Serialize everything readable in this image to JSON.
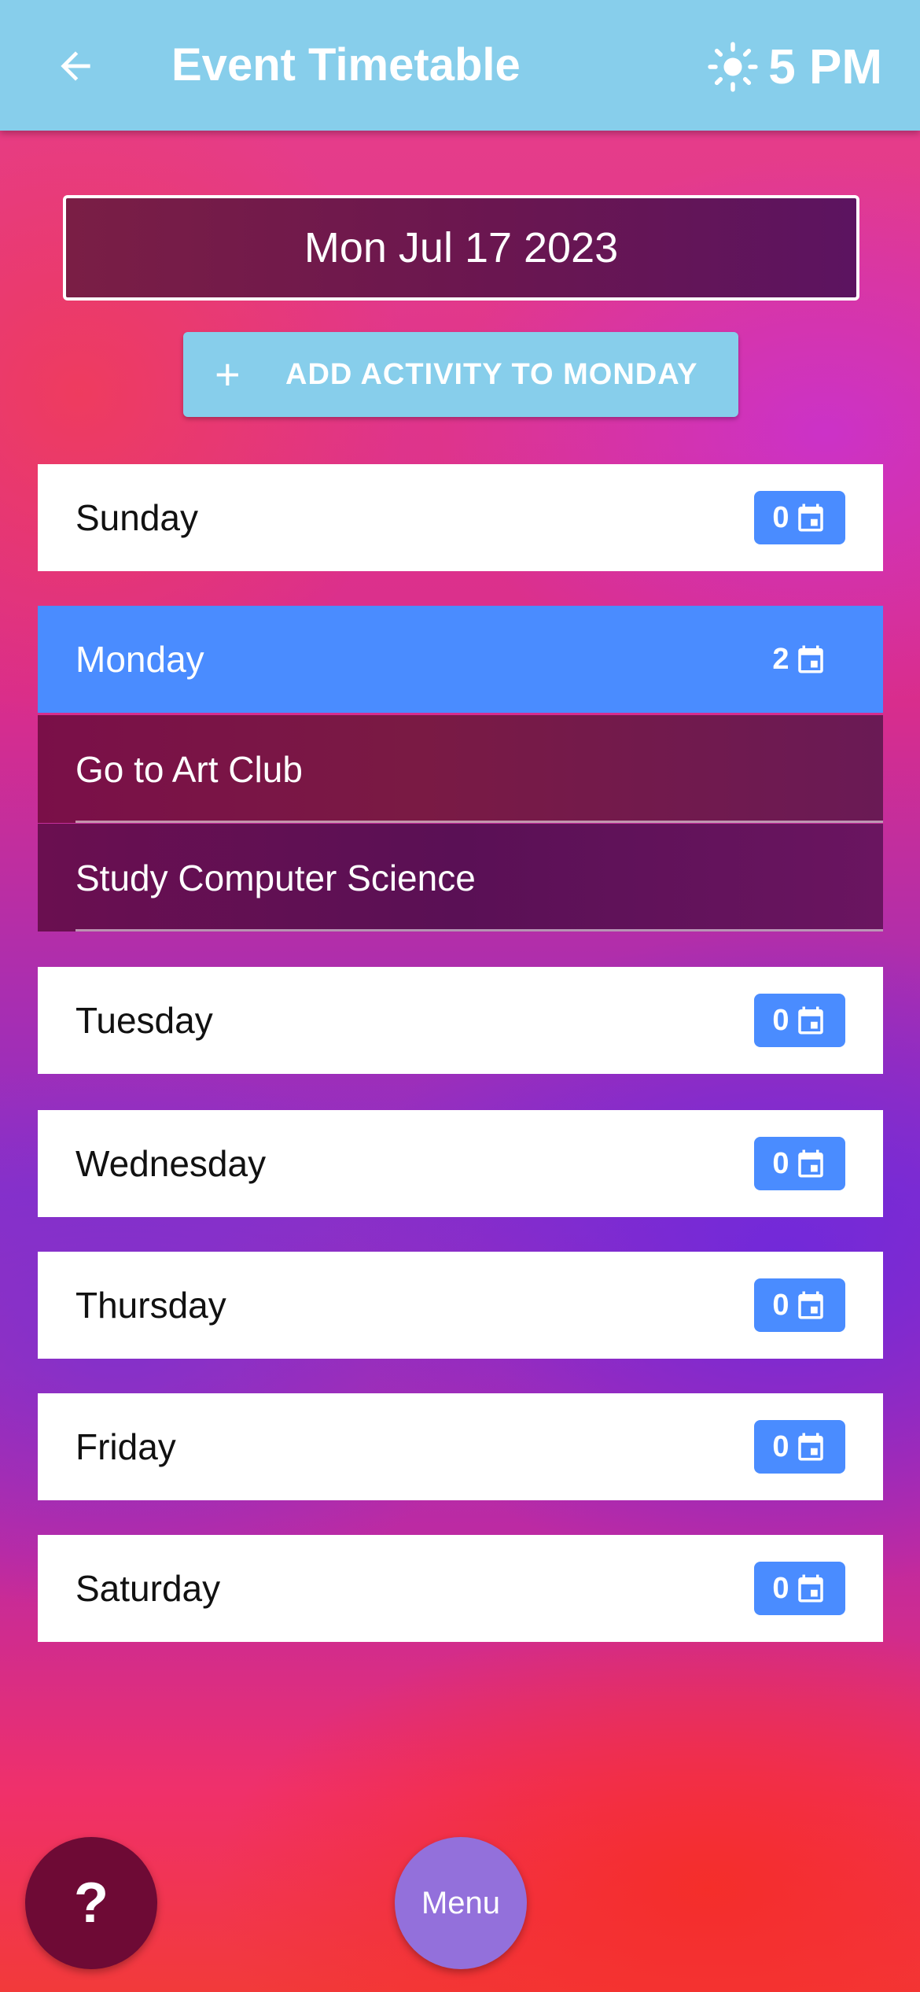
{
  "header": {
    "title": "Event Timetable",
    "weather_text": "5 PM",
    "back_icon": "arrow-left-icon",
    "weather_icon": "sun-icon"
  },
  "date": {
    "label": "Mon Jul 17 2023"
  },
  "add_button": {
    "icon": "+",
    "label": "ADD ACTIVITY TO MONDAY"
  },
  "days": [
    {
      "name": "Sunday",
      "count": "0"
    },
    {
      "name": "Monday",
      "count": "2"
    },
    {
      "name": "Tuesday",
      "count": "0"
    },
    {
      "name": "Wednesday",
      "count": "0"
    },
    {
      "name": "Thursday",
      "count": "0"
    },
    {
      "name": "Friday",
      "count": "0"
    },
    {
      "name": "Saturday",
      "count": "0"
    }
  ],
  "monday_activities": [
    "Go to Art Club",
    "Study Computer Science"
  ],
  "fab": {
    "help_label": "?",
    "menu_label": "Menu"
  },
  "colors": {
    "appbar": "#87ceeb",
    "badge": "#4a8cff",
    "active_row": "#4a8cff",
    "help_fab": "#6e0a35",
    "menu_fab": "#9370db"
  }
}
